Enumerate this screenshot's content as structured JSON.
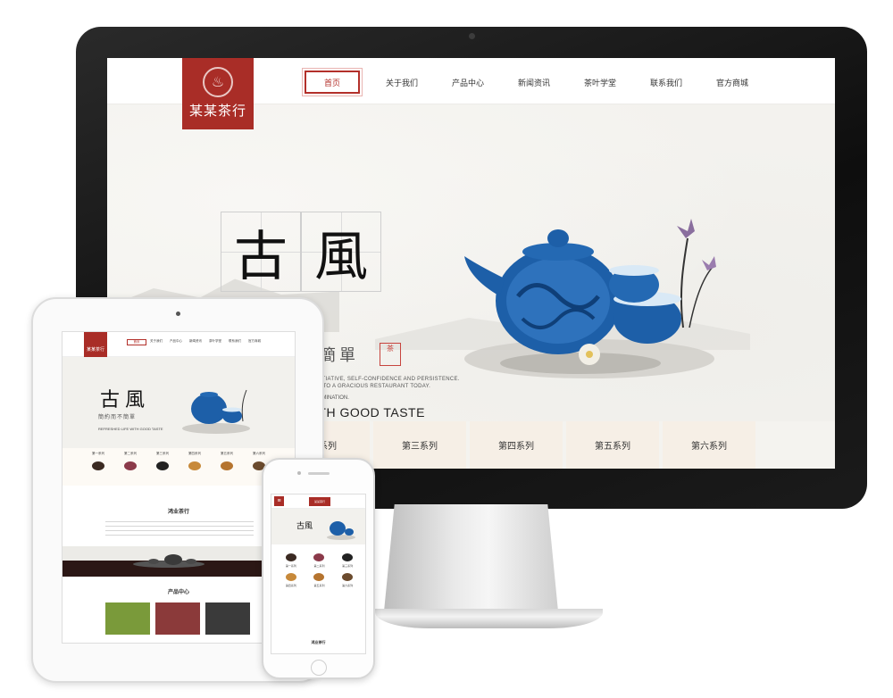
{
  "desktop": {
    "logo_text": "某某茶行",
    "nav": [
      {
        "label": "首页"
      },
      {
        "label": "关于我们"
      },
      {
        "label": "产品中心"
      },
      {
        "label": "新闻资讯"
      },
      {
        "label": "茶叶学堂"
      },
      {
        "label": "联系我们"
      },
      {
        "label": "官方商城"
      }
    ],
    "hero": {
      "glyph_1": "古",
      "glyph_2": "風",
      "subtitle": "簡單",
      "seal": "茶",
      "en_line_1": "INITIATIVE, SELF-CONFIDENCE AND PERSISTENCE.",
      "en_line_2": "AT TO A GRACIOUS RESTAURANT TODAY.",
      "en_line_3": "ERMINATION.",
      "slogan": "ITH GOOD TASTE"
    },
    "series": [
      {
        "label": "二系列"
      },
      {
        "label": "第三系列"
      },
      {
        "label": "第四系列"
      },
      {
        "label": "第五系列"
      },
      {
        "label": "第六系列"
      }
    ]
  },
  "tablet": {
    "logo_text": "某某茶行",
    "nav": [
      "首页",
      "关于我们",
      "产品中心",
      "新闻资讯",
      "茶叶学堂",
      "联系我们",
      "官方商城"
    ],
    "hero_glyph_1": "古",
    "hero_glyph_2": "風",
    "hero_sub": "簡約而不簡單",
    "hero_en": "REFRESHED LIFE WITH GOOD TASTE",
    "series": [
      "第一系列",
      "第二系列",
      "第三系列",
      "第四系列",
      "第五系列",
      "第六系列"
    ],
    "section_about": "鸿业茶行",
    "section_products": "产品中心"
  },
  "phone": {
    "menu_icon": "≡",
    "logo_text": "某某茶行",
    "hero_glyph": "古風",
    "series": [
      "第一系列",
      "第二系列",
      "第三系列",
      "第四系列",
      "第五系列",
      "第六系列"
    ],
    "section_title": "鸿业茶行"
  },
  "colors": {
    "brand_red": "#a92d27",
    "porcelain_blue": "#1d5fa8",
    "series_bg": "#f6efe6"
  }
}
